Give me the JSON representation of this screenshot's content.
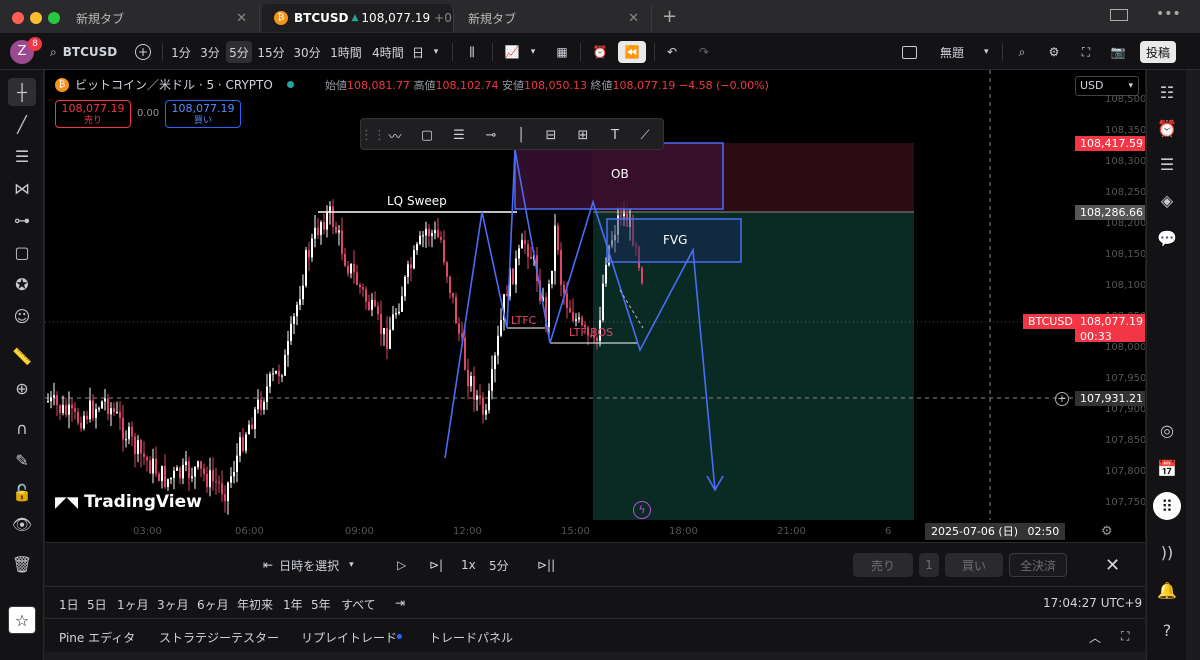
{
  "browser": {
    "tabs": [
      {
        "label": "新規タブ"
      },
      {
        "label": "BTCUSD",
        "price": "108,077.19",
        "change": "+0"
      },
      {
        "label": "新規タブ"
      }
    ]
  },
  "toolbar": {
    "avatar_letter": "Z",
    "avatar_badge": "8",
    "symbol": "BTCUSD",
    "intervals": [
      "1分",
      "3分",
      "5分",
      "15分",
      "30分",
      "1時間",
      "4時間",
      "日"
    ],
    "selected_interval": "5分",
    "layout_name": "無題",
    "publish_label": "投稿"
  },
  "chart": {
    "title": "ビットコイン／米ドル · 5 · CRYPTO",
    "ohlc": {
      "open_label": "始値",
      "open": "108,081.77",
      "high_label": "高値",
      "high": "108,102.74",
      "low_label": "安値",
      "low": "108,050.13",
      "close_label": "終値",
      "close": "108,077.19",
      "change": "−4.58 (−0.00%)"
    },
    "sell": {
      "price": "108,077.19",
      "label": "売り"
    },
    "spread": "0.00",
    "buy": {
      "price": "108,077.19",
      "label": "買い"
    },
    "currency": "USD",
    "price_tags": {
      "target": "108,417.59",
      "level": "108,286.66",
      "symbol_label": "BTCUSD",
      "last": "108,077.19",
      "countdown": "00:33",
      "crosshair": "107,931.21"
    },
    "y_ticks": [
      "108,500.00",
      "108,350.00",
      "108,300.00",
      "108,250.00",
      "108,200.00",
      "108,150.00",
      "108,100.00",
      "108,050.00",
      "108,000.00",
      "107,950.00",
      "107,900.00",
      "107,850.00",
      "107,800.00",
      "107,750.00"
    ],
    "x_ticks": [
      "03:00",
      "06:00",
      "09:00",
      "12:00",
      "15:00",
      "18:00",
      "21:00",
      "6"
    ],
    "crosshair_date": "2025-07-06 (日)",
    "crosshair_time": "02:50",
    "annotations": {
      "lq_sweep": "LQ Sweep",
      "ob": "OB",
      "fvg": "FVG",
      "ltf_c": "LTFC",
      "ltf_bos": "LTF BOS"
    },
    "watermark": "TradingView"
  },
  "replay": {
    "select_date": "日時を選択",
    "speed": "1x",
    "interval": "5分",
    "sell_label": "売り",
    "qty": "1",
    "buy_label": "買い",
    "close_all": "全決済"
  },
  "ranges": {
    "items": [
      "1日",
      "5日",
      "1ヶ月",
      "3ヶ月",
      "6ヶ月",
      "年初来",
      "1年",
      "5年",
      "すべて"
    ],
    "clock": "17:04:27 UTC+9"
  },
  "bottom_tabs": [
    "Pine エディタ",
    "ストラテジーテスター",
    "リプレイトレード",
    "トレードパネル"
  ],
  "colors": {
    "bull": "#ffffff",
    "bear": "#e0466a",
    "accent": "#4a6cf7",
    "ob_fill": "#3a1030",
    "target_zone": "#0a2a24",
    "stop_zone": "#2a0c12"
  }
}
